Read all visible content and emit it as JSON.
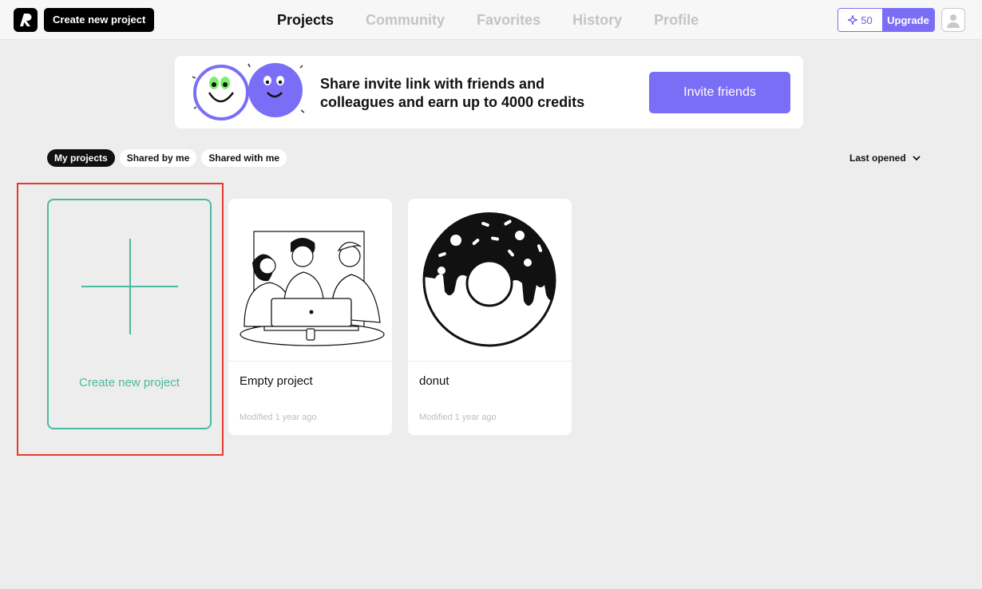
{
  "header": {
    "create_label": "Create new project",
    "nav": [
      {
        "label": "Projects",
        "active": true
      },
      {
        "label": "Community",
        "active": false
      },
      {
        "label": "Favorites",
        "active": false
      },
      {
        "label": "History",
        "active": false
      },
      {
        "label": "Profile",
        "active": false
      }
    ],
    "credits": "50",
    "upgrade_label": "Upgrade"
  },
  "banner": {
    "line1": "Share invite link with friends and",
    "line2": "colleagues and earn up to 4000 credits",
    "button_label": "Invite friends"
  },
  "filters": [
    {
      "label": "My projects",
      "active": true
    },
    {
      "label": "Shared by me",
      "active": false
    },
    {
      "label": "Shared with me",
      "active": false
    }
  ],
  "sort_label": "Last opened",
  "new_project_label": "Create new project",
  "projects": [
    {
      "title": "Empty project",
      "modified": "Modified 1 year ago"
    },
    {
      "title": "donut",
      "modified": "Modified 1 year ago"
    }
  ],
  "colors": {
    "accent": "#7b6ef6",
    "create_card": "#4cb8a0",
    "highlight": "#e53a2f"
  }
}
